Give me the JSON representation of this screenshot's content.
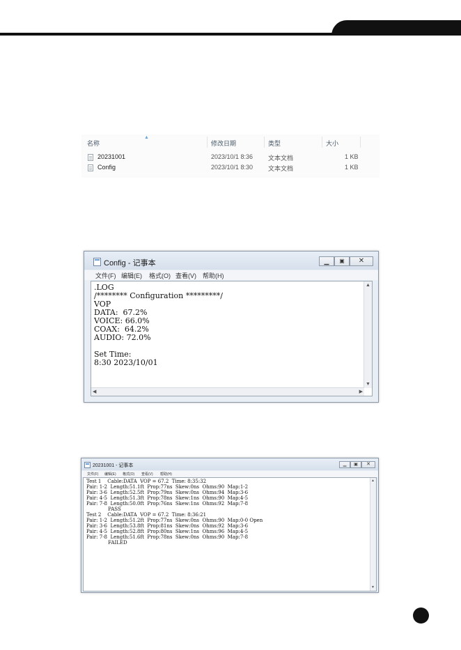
{
  "explorer": {
    "columns": [
      "名称",
      "修改日期",
      "类型",
      "大小"
    ],
    "files": [
      {
        "name": "20231001",
        "modified": "2023/10/1 8:36",
        "type": "文本文档",
        "size": "1 KB"
      },
      {
        "name": "Config",
        "modified": "2023/10/1 8:30",
        "type": "文本文档",
        "size": "1 KB"
      }
    ]
  },
  "config_window": {
    "title": "Config - 记事本",
    "menu": [
      "文件(F)",
      "编辑(E)",
      "格式(O)",
      "查看(V)",
      "帮助(H)"
    ],
    "lines": [
      ".LOG",
      "/******** Configuration *********/",
      "VOP",
      "DATA:  67.2%",
      "VOICE: 66.0%",
      "COAX:  64.2%",
      "AUDIO: 72.0%",
      "",
      "Set Time:",
      "8:30 2023/10/01"
    ]
  },
  "log_window": {
    "title": "20231001 - 记事本",
    "menu": [
      "文件(F)",
      "编辑(E)",
      "格式(O)",
      "查看(V)",
      "帮助(H)"
    ],
    "lines": [
      "Test 1    Cable:DATA  VOP = 67.2  Time: 8:35:32",
      "Pair: 1-2  Length:51.1ft  Prop:77ns  Skew:0ns  Ohms:90  Map:1-2",
      "Pair: 3-6  Length:52.5ft  Prop:79ns  Skew:0ns  Ohms:94  Map:3-6",
      "Pair: 4-5  Length:51.3ft  Prop:78ns  Skew:1ns  Ohms:90  Map:4-5",
      "Pair: 7-8  Length:50.0ft  Prop:76ns  Skew:1ns  Ohms:92  Map:7-8",
      "              PASS",
      "Test 2    Cable:DATA  VOP = 67.2  Time: 8:36:21",
      "Pair: 1-2  Length:51.2ft  Prop:77ns  Skew:0ns  Ohms:90  Map:0-0 Open",
      "Pair: 3-6  Length:53.8ft  Prop:81ns  Skew:0ns  Ohms:92  Map:3-6",
      "Pair: 4-5  Length:52.8ft  Prop:80ns  Skew:1ns  Ohms:96  Map:4-5",
      "Pair: 7-8  Length:51.6ft  Prop:78ns  Skew:0ns  Ohms:90  Map:7-8",
      "              FAILED"
    ]
  }
}
